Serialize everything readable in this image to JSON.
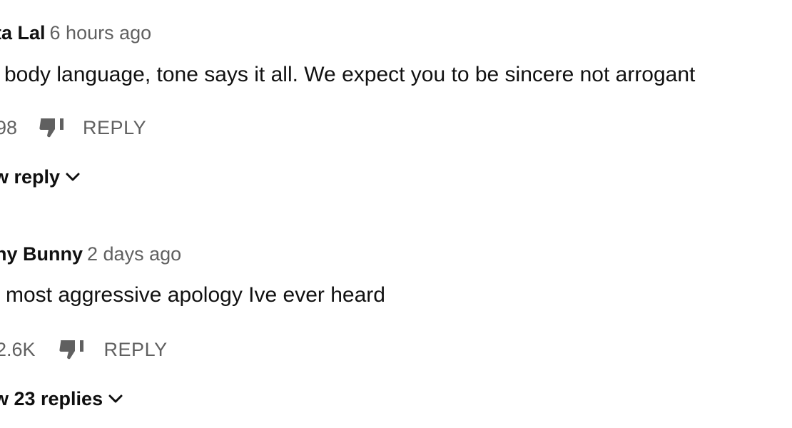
{
  "comments": [
    {
      "author": "ta Lal",
      "timestamp": "6 hours ago",
      "text": "body language, tone says it all. We expect you to be sincere not arrogant",
      "likes": "98",
      "reply_label": "REPLY",
      "view_replies_label": "w reply",
      "icons": {
        "dislike": "thumbs-down-icon",
        "expand": "chevron-down-icon"
      }
    },
    {
      "author": "ny Bunny",
      "timestamp": "2 days ago",
      "text": "most aggressive apology Ive ever heard",
      "likes": "2.6K",
      "reply_label": "REPLY",
      "view_replies_label": "w 23 replies",
      "icons": {
        "dislike": "thumbs-down-icon",
        "expand": "chevron-down-icon"
      }
    }
  ],
  "colors": {
    "text_primary": "#111111",
    "text_secondary": "#606060",
    "icon": "#606060",
    "background": "#ffffff"
  }
}
